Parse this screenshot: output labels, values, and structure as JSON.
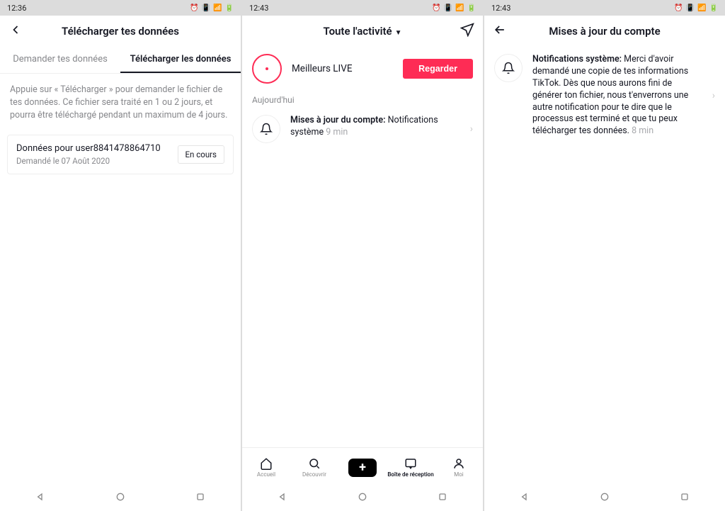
{
  "screens": [
    {
      "status_time": "12:36",
      "header_title": "Télécharger tes données",
      "tabs": [
        "Demander tes données",
        "Télécharger les données"
      ],
      "info": "Appuie sur « Télécharger » pour demander le fichier de tes données. Ce fichier sera traité en 1 ou 2 jours, et pourra être téléchargé pendant un maximum de 4 jours.",
      "card_title": "Données pour user8841478864710",
      "card_sub": "Demandé le 07 Août 2020",
      "card_status": "En cours"
    },
    {
      "status_time": "12:43",
      "header_title": "Toute l'activité",
      "live_label": "Meilleurs LIVE",
      "watch_label": "Regarder",
      "section": "Aujourd'hui",
      "notif_bold": "Mises à jour du compte:",
      "notif_rest": " Notifications système",
      "notif_time": " 9 min",
      "bottom": {
        "home": "Accueil",
        "discover": "Découvrir",
        "inbox": "Boîte de réception",
        "me": "Moi"
      }
    },
    {
      "status_time": "12:43",
      "header_title": "Mises à jour du compte",
      "notif_bold": "Notifications système:",
      "notif_rest": " Merci d'avoir demandé une copie de tes informations TikTok. Dès que nous aurons fini de générer ton fichier, nous t'enverrons une autre notification pour te dire que le processus est terminé et que tu peux télécharger tes données.",
      "notif_time": " 8 min"
    }
  ]
}
